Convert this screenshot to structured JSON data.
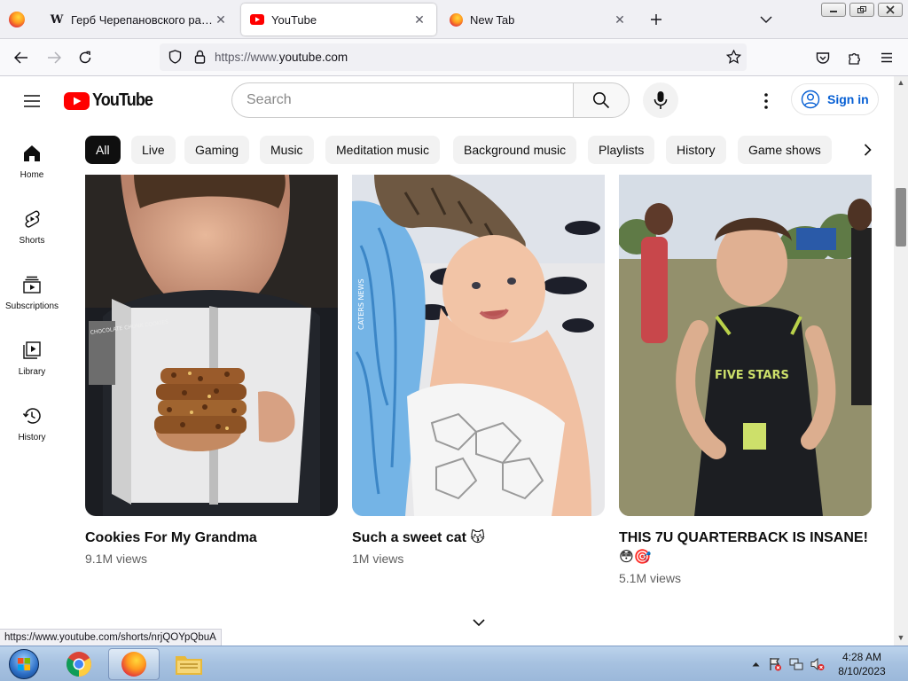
{
  "browser": {
    "tabs": [
      {
        "title": "Герб Черепановского района",
        "favicon": "wikipedia-icon",
        "active": false
      },
      {
        "title": "YouTube",
        "favicon": "youtube-icon",
        "active": true
      },
      {
        "title": "New Tab",
        "favicon": "firefox-icon",
        "active": false
      }
    ],
    "url_prefix": "https://www.",
    "url_domain": "youtube.com"
  },
  "youtube": {
    "logo_text": "YouTube",
    "search_placeholder": "Search",
    "signin_label": "Sign in",
    "sidebar": [
      {
        "label": "Home",
        "icon": "home-icon"
      },
      {
        "label": "Shorts",
        "icon": "shorts-icon"
      },
      {
        "label": "Subscriptions",
        "icon": "subscriptions-icon"
      },
      {
        "label": "Library",
        "icon": "library-icon"
      },
      {
        "label": "History",
        "icon": "history-icon"
      }
    ],
    "chips": [
      "All",
      "Live",
      "Gaming",
      "Music",
      "Meditation music",
      "Background music",
      "Playlists",
      "History",
      "Game shows"
    ],
    "videos": [
      {
        "title": "Cookies For My Grandma",
        "views": "9.1M views"
      },
      {
        "title": "Such a sweet cat 😽",
        "views": "1M views"
      },
      {
        "title": "THIS 7U QUARTERBACK IS INSANE! 😳🎯",
        "views": "5.1M views"
      }
    ],
    "thumbnail_text": {
      "book_cover": "CHOCOLATE CHUNK COOKIES",
      "watermark": "CATERS NEWS",
      "jersey": "FIVE STARS"
    }
  },
  "status_url": "https://www.youtube.com/shorts/nrjQOYpQbuA",
  "taskbar": {
    "apps": [
      "chrome-icon",
      "firefox-icon",
      "explorer-icon"
    ],
    "time": "4:28 AM",
    "date": "8/10/2023"
  },
  "colors": {
    "youtube_red": "#ff0000",
    "link_blue": "#065fd4",
    "chip_bg": "#f2f2f2"
  }
}
